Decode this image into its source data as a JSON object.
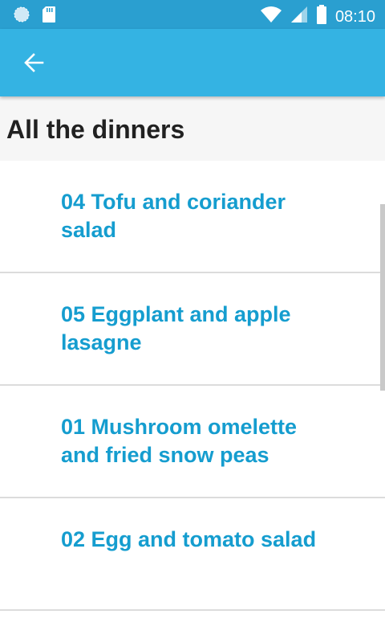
{
  "status_bar": {
    "time": "08:10",
    "icons": [
      "globe-icon",
      "sd-card-icon",
      "wifi-icon",
      "cell-signal-icon",
      "battery-icon"
    ]
  },
  "app_bar": {
    "back_icon": "arrow-left-icon"
  },
  "header": {
    "title": "All the dinners"
  },
  "dinners": [
    {
      "title": "04 Tofu and coriander salad"
    },
    {
      "title": "05 Eggplant and apple lasagne"
    },
    {
      "title": "01 Mushroom omelette and fried snow peas"
    },
    {
      "title": "02 Egg and tomato salad"
    }
  ],
  "colors": {
    "status_bar": "#2a9fd0",
    "app_bar": "#34b3e3",
    "item_text": "#159dcf",
    "title_text": "#212121"
  }
}
